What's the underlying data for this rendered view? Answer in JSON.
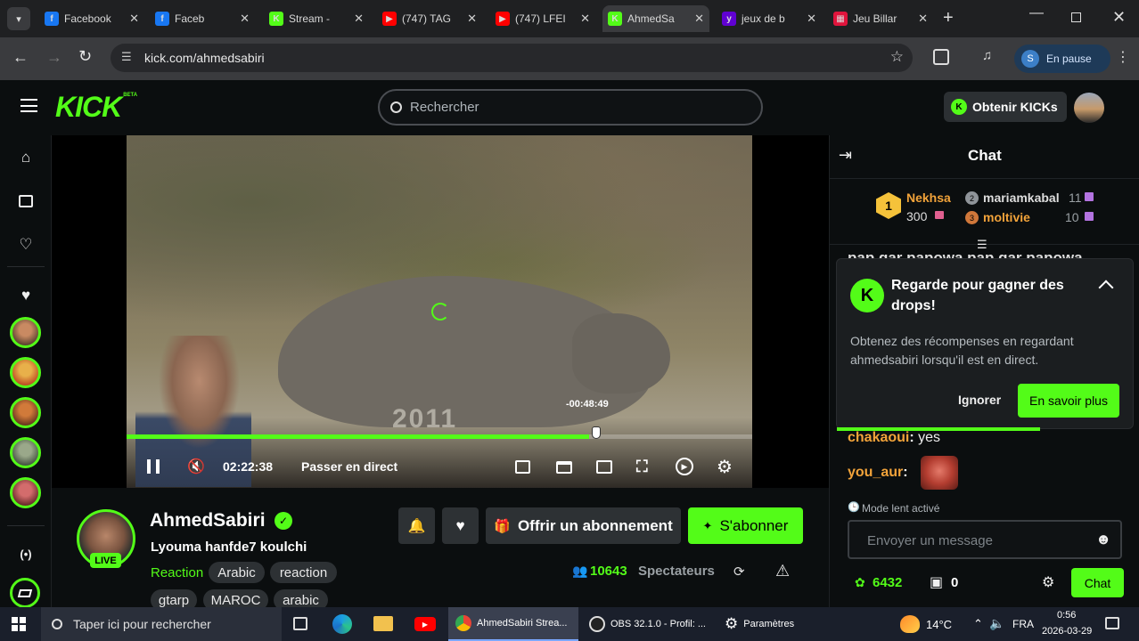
{
  "browser": {
    "tabs": [
      {
        "label": "Facebook",
        "icon": "facebook-icon",
        "color": "#1877f2"
      },
      {
        "label": "Faceb",
        "icon": "facebook-icon",
        "color": "#1877f2"
      },
      {
        "label": "Stream - ",
        "icon": "kick-icon",
        "color": "#53fc18"
      },
      {
        "label": "(747) TAG",
        "icon": "youtube-icon",
        "color": "#ff0000"
      },
      {
        "label": "(747) LFEI",
        "icon": "youtube-icon",
        "color": "#ff0000"
      },
      {
        "label": "AhmedSa",
        "icon": "kick-icon",
        "color": "#53fc18"
      },
      {
        "label": "jeux de b",
        "icon": "yahoo-icon",
        "color": "#6001d2"
      },
      {
        "label": "Jeu Billar",
        "icon": "game-icon",
        "color": "#e0143c"
      }
    ],
    "url": "kick.com/ahmedsabiri",
    "profile_initial": "S",
    "profile_status": "En pause"
  },
  "header": {
    "logo": "KICK",
    "logo_badge": "BETA",
    "search_placeholder": "Rechercher",
    "get_kicks": "Obtenir KICKs"
  },
  "player": {
    "time_remaining": "-00:48:49",
    "watermark": "2011",
    "current_time": "02:22:38",
    "go_live": "Passer en direct",
    "progress": 0.74
  },
  "channel": {
    "name": "AhmedSabiri",
    "title": "Lyouma hanfde7 koulchi",
    "live_badge": "LIVE",
    "category": "Reaction",
    "tags": [
      "Arabic",
      "reaction",
      "gtarp",
      "MAROC",
      "arabic"
    ],
    "gift_label": "Offrir un abonnement",
    "subscribe_label": "S'abonner",
    "viewers_count": "10643",
    "viewers_label": "Spectateurs"
  },
  "chat": {
    "title": "Chat",
    "leaderboard": [
      {
        "rank": "1",
        "name": "Nekhsa",
        "value": "300"
      },
      {
        "rank": "2",
        "name": "mariamkabal",
        "value": "11"
      },
      {
        "rank": "3",
        "name": "moltivie",
        "value": "10"
      }
    ],
    "overflow_text": "pap gar papowa pap gar papowa",
    "popup": {
      "title": "Regarde pour gagner des drops!",
      "body": "Obtenez des récompenses en regardant ahmedsabiri lorsqu'il est en direct.",
      "ignore": "Ignorer",
      "learn_more": "En savoir plus"
    },
    "messages": [
      {
        "user": "chakaoui",
        "text": "yes",
        "color": "#f2a33a"
      },
      {
        "user": "you_aur",
        "text": "",
        "color": "#f2a33a"
      }
    ],
    "slow_mode": "Mode lent activé",
    "input_placeholder": "Envoyer un message",
    "points": "6432",
    "gifts": "0",
    "send_label": "Chat"
  },
  "taskbar": {
    "search_placeholder": "Taper ici pour rechercher",
    "apps": [
      {
        "label": "AhmedSabiri Strea...",
        "icon": "chrome-icon"
      },
      {
        "label": "OBS 32.1.0 - Profil: ...",
        "icon": "obs-icon"
      },
      {
        "label": "Paramètres",
        "icon": "gear-icon"
      }
    ],
    "temperature": "14°C",
    "language": "FRA",
    "time": "0:56",
    "date": "2026-03-29"
  },
  "colors": {
    "accent": "#53fc18",
    "chrome_bg": "#1f2022",
    "page_bg": "#0b0e0f"
  }
}
